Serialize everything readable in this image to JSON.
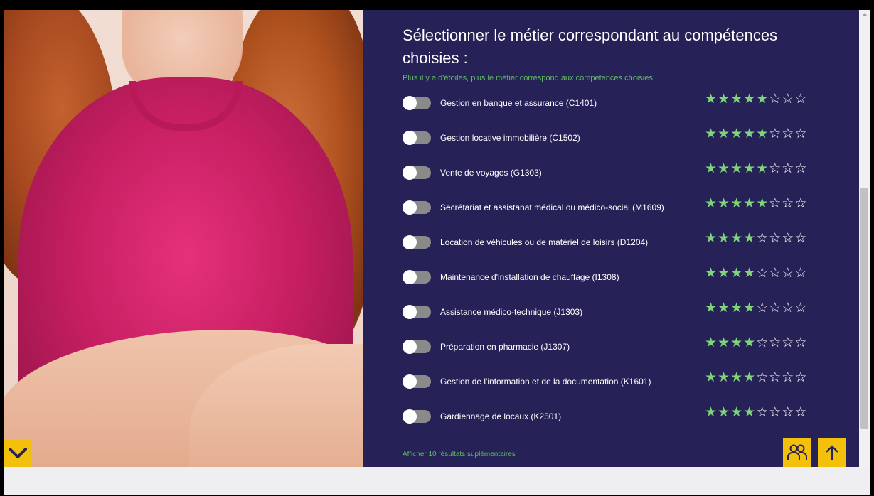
{
  "panel": {
    "title": "Sélectionner le métier correspondant au compétences choisies :",
    "subtitle": "Plus il y a d'étoiles, plus le métier correspond aux compétences choisies.",
    "more_results": "Afficher 10 résultats suplémentaires"
  },
  "jobs": [
    {
      "label": "Gestion en banque et assurance (C1401)",
      "stars": 5,
      "max_stars": 8
    },
    {
      "label": "Gestion locative immobilière (C1502)",
      "stars": 5,
      "max_stars": 8
    },
    {
      "label": "Vente de voyages (G1303)",
      "stars": 5,
      "max_stars": 8
    },
    {
      "label": "Secrétariat et assistanat médical ou médico-social (M1609)",
      "stars": 5,
      "max_stars": 8
    },
    {
      "label": "Location de véhicules ou de matériel de loisirs (D1204)",
      "stars": 4,
      "max_stars": 8
    },
    {
      "label": "Maintenance d'installation de chauffage (I1308)",
      "stars": 4,
      "max_stars": 8
    },
    {
      "label": "Assistance médico-technique (J1303)",
      "stars": 4,
      "max_stars": 8
    },
    {
      "label": "Préparation en pharmacie (J1307)",
      "stars": 4,
      "max_stars": 8
    },
    {
      "label": "Gestion de l'information et de la documentation (K1601)",
      "stars": 4,
      "max_stars": 8
    },
    {
      "label": "Gardiennage de locaux (K2501)",
      "stars": 4,
      "max_stars": 8
    }
  ],
  "colors": {
    "panel_bg": "#262257",
    "accent_yellow": "#f3c10b",
    "star_green": "#7fd37b",
    "subtitle_green": "#5fbf5f"
  },
  "icons": {
    "scroll_down": "chevron-down-icon",
    "people": "people-icon",
    "back_to_top": "arrow-up-icon"
  }
}
